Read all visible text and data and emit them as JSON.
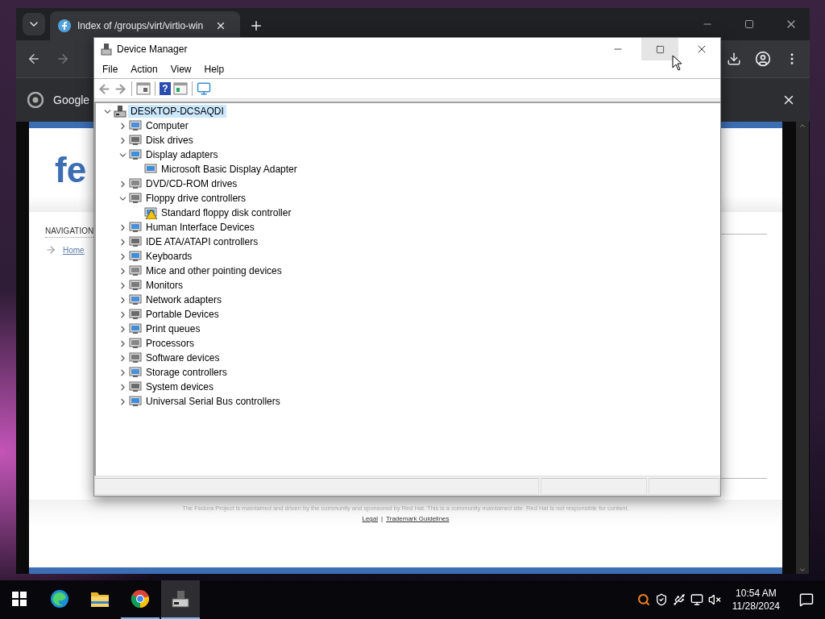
{
  "browser": {
    "tab": {
      "title": "Index of /groups/virt/virtio-win",
      "selected": true
    },
    "infobar": {
      "text": "Google"
    },
    "page": {
      "logo": "fe",
      "navigation": {
        "heading": "NAVIGATION",
        "link": "Home"
      },
      "footer": {
        "text": "The Fedora Project is maintained and driven by the community and sponsored by Red Hat. This is a community maintained site. Red Hat is not responsible for content.",
        "links": [
          "Legal",
          "Trademark Guidelines"
        ],
        "separator": "|"
      }
    }
  },
  "device_manager": {
    "title": "Device Manager",
    "menu": [
      "File",
      "Action",
      "View",
      "Help"
    ],
    "toolbar": {
      "help_glyph": "?"
    },
    "tree": {
      "label": "DESKTOP-DCSAQDI",
      "expanded": true,
      "selected": true,
      "children": [
        {
          "label": "Computer",
          "expanded": false
        },
        {
          "label": "Disk drives",
          "expanded": false
        },
        {
          "label": "Display adapters",
          "expanded": true,
          "children": [
            {
              "label": "Microsoft Basic Display Adapter",
              "warning": false
            }
          ]
        },
        {
          "label": "DVD/CD-ROM drives",
          "expanded": false
        },
        {
          "label": "Floppy drive controllers",
          "expanded": true,
          "children": [
            {
              "label": "Standard floppy disk controller",
              "warning": true
            }
          ]
        },
        {
          "label": "Human Interface Devices",
          "expanded": false
        },
        {
          "label": "IDE ATA/ATAPI controllers",
          "expanded": false
        },
        {
          "label": "Keyboards",
          "expanded": false
        },
        {
          "label": "Mice and other pointing devices",
          "expanded": false
        },
        {
          "label": "Monitors",
          "expanded": false
        },
        {
          "label": "Network adapters",
          "expanded": false
        },
        {
          "label": "Portable Devices",
          "expanded": false
        },
        {
          "label": "Print queues",
          "expanded": false
        },
        {
          "label": "Processors",
          "expanded": false
        },
        {
          "label": "Software devices",
          "expanded": false
        },
        {
          "label": "Storage controllers",
          "expanded": false
        },
        {
          "label": "System devices",
          "expanded": false
        },
        {
          "label": "Universal Serial Bus controllers",
          "expanded": false
        }
      ]
    }
  },
  "taskbar": {
    "apps": [
      {
        "kind": "edge",
        "running": false,
        "selected": false
      },
      {
        "kind": "explorer",
        "running": false,
        "selected": false
      },
      {
        "kind": "chrome",
        "running": true,
        "selected": false
      },
      {
        "kind": "device-manager",
        "running": true,
        "selected": true
      }
    ],
    "time": "10:54 AM",
    "date": "11/28/2024"
  }
}
